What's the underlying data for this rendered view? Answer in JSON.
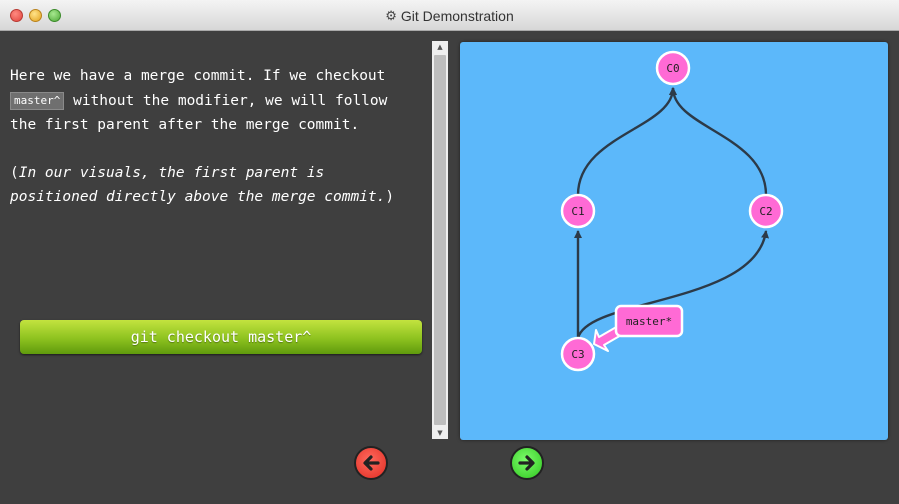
{
  "window": {
    "title": "Git Demonstration",
    "title_icon": "gear-icon"
  },
  "instructions": {
    "p1_a": "Here we have a merge commit. If we checkout ",
    "p1_code": "master^",
    "p1_b": " without the modifier, we will follow the first parent after the merge commit.",
    "p2_open": "(",
    "p2_italic": "In our visuals, the first parent is positioned directly above the merge commit.",
    "p2_close": ")"
  },
  "command_button": {
    "label": "git checkout master^"
  },
  "graph": {
    "background": "#5cb8fa",
    "node_color": "#ff6ad5",
    "edge_color": "#2c3a48",
    "nodes": [
      {
        "id": "C0",
        "label": "C0"
      },
      {
        "id": "C1",
        "label": "C1"
      },
      {
        "id": "C2",
        "label": "C2"
      },
      {
        "id": "C3",
        "label": "C3"
      }
    ],
    "edges": [
      {
        "from": "C1",
        "to": "C0"
      },
      {
        "from": "C2",
        "to": "C0"
      },
      {
        "from": "C3",
        "to": "C1"
      },
      {
        "from": "C3",
        "to": "C2"
      }
    ],
    "branch": {
      "label": "master*",
      "target": "C3"
    }
  },
  "nav": {
    "back_color": "#e0443e",
    "forward_color": "#3fd42b"
  }
}
